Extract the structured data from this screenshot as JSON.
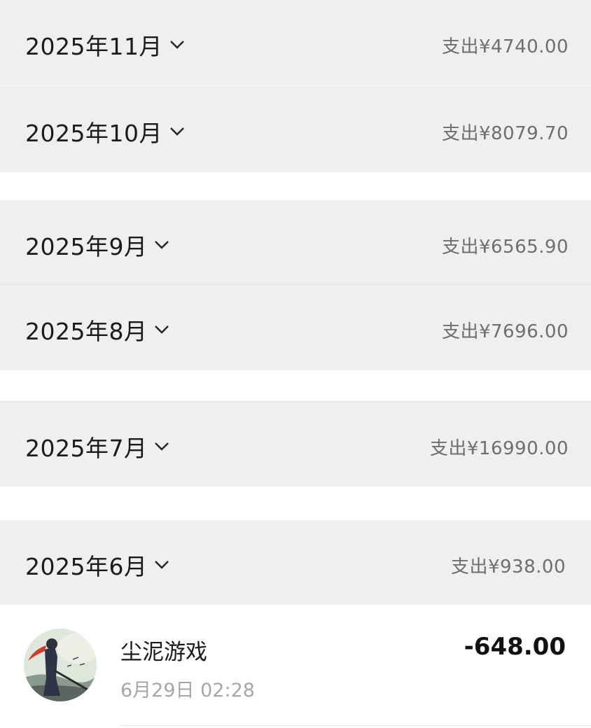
{
  "months": [
    {
      "label": "2025年11月",
      "spend": "支出¥4740.00"
    },
    {
      "label": "2025年10月",
      "spend": "支出¥8079.70"
    },
    {
      "label": "2025年9月",
      "spend": "支出¥6565.90"
    },
    {
      "label": "2025年8月",
      "spend": "支出¥7696.00"
    },
    {
      "label": "2025年7月",
      "spend": "支出¥16990.00"
    },
    {
      "label": "2025年6月",
      "spend": "支出¥938.00"
    }
  ],
  "transaction": {
    "merchant": "尘泥游戏",
    "time": "6月29日 02:28",
    "amount": "-648.00"
  },
  "colors": {
    "header_bg": "#efefef",
    "muted_text": "#6e6e6e",
    "time_text": "#a6a6a6"
  }
}
